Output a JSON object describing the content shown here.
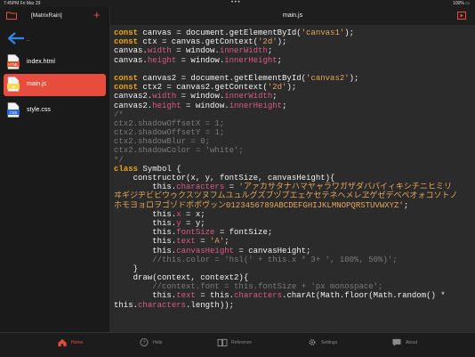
{
  "status": {
    "time": "7:45PM",
    "date": "Fri Mar 29",
    "battery": "100%"
  },
  "sidebar": {
    "title": "[MatrixRain]",
    "back_label": "..",
    "files": [
      {
        "name": "index.html",
        "type": "html",
        "color": "#e34c26"
      },
      {
        "name": "main.js",
        "type": "js",
        "color": "#f0db4f",
        "active": true
      },
      {
        "name": "style.css",
        "type": "css",
        "color": "#2965f1"
      }
    ]
  },
  "editor": {
    "filename": "main.js",
    "code_lines": [
      [
        {
          "t": "const ",
          "c": "kw"
        },
        {
          "t": "canvas = document.getElementById(",
          "c": "p"
        },
        {
          "t": "'canvas1'",
          "c": "s"
        },
        {
          "t": ");",
          "c": "p"
        }
      ],
      [
        {
          "t": "const ",
          "c": "kw"
        },
        {
          "t": "ctx = canvas.getContext(",
          "c": "p"
        },
        {
          "t": "'2d'",
          "c": "s"
        },
        {
          "t": ");",
          "c": "p"
        }
      ],
      [
        {
          "t": "canvas.",
          "c": "p"
        },
        {
          "t": "width",
          "c": "prop"
        },
        {
          "t": " = window.",
          "c": "p"
        },
        {
          "t": "innerWidth",
          "c": "prop"
        },
        {
          "t": ";",
          "c": "p"
        }
      ],
      [
        {
          "t": "canvas.",
          "c": "p"
        },
        {
          "t": "height",
          "c": "prop"
        },
        {
          "t": " = window.",
          "c": "p"
        },
        {
          "t": "innerHeight",
          "c": "prop"
        },
        {
          "t": ";",
          "c": "p"
        }
      ],
      [],
      [
        {
          "t": "const ",
          "c": "kw"
        },
        {
          "t": "canvas2 = document.getElementById(",
          "c": "p"
        },
        {
          "t": "'canvas2'",
          "c": "s"
        },
        {
          "t": ");",
          "c": "p"
        }
      ],
      [
        {
          "t": "const ",
          "c": "kw"
        },
        {
          "t": "ctx2 = canvas2.getContext(",
          "c": "p"
        },
        {
          "t": "'2d'",
          "c": "s"
        },
        {
          "t": ");",
          "c": "p"
        }
      ],
      [
        {
          "t": "canvas2.",
          "c": "p"
        },
        {
          "t": "width",
          "c": "prop"
        },
        {
          "t": " = window.",
          "c": "p"
        },
        {
          "t": "innerWidth",
          "c": "prop"
        },
        {
          "t": ";",
          "c": "p"
        }
      ],
      [
        {
          "t": "canvas2.",
          "c": "p"
        },
        {
          "t": "height",
          "c": "prop"
        },
        {
          "t": " = window.",
          "c": "p"
        },
        {
          "t": "innerHeight",
          "c": "prop"
        },
        {
          "t": ";",
          "c": "p"
        }
      ],
      [
        {
          "t": "/*",
          "c": "cm"
        }
      ],
      [
        {
          "t": "ctx2.shadowOffsetX = 1;",
          "c": "cm"
        }
      ],
      [
        {
          "t": "ctx2.shadowOffsetY = 1;",
          "c": "cm"
        }
      ],
      [
        {
          "t": "ctx2.shadowBlur = 0;",
          "c": "cm"
        }
      ],
      [
        {
          "t": "ctx2.shadowColor = 'white';",
          "c": "cm"
        }
      ],
      [
        {
          "t": "*/",
          "c": "cm"
        }
      ],
      [
        {
          "t": "class ",
          "c": "kw"
        },
        {
          "t": "Symbol {",
          "c": "p"
        }
      ],
      [
        {
          "t": "    constructor(x, y, fontSize, canvasHeight){",
          "c": "p"
        }
      ],
      [
        {
          "t": "        this.",
          "c": "p"
        },
        {
          "t": "characters",
          "c": "prop"
        },
        {
          "t": " = ",
          "c": "p"
        },
        {
          "t": "'アァカサタナハマヤャラワガザダバパイィキシチニヒミリ",
          "c": "s"
        }
      ],
      [
        {
          "t": "ヰギジヂビピウゥクスツヌフムユュルグズブヅプエェケセテネヘメレヱゲゼデベペオォコソトノ",
          "c": "s"
        }
      ],
      [
        {
          "t": "ホモヨョロヲゴゾドボポヴッン0123456789ABCDEFGHIJKLMNOPQRSTUVWXYZ'",
          "c": "s"
        },
        {
          "t": ";",
          "c": "p"
        }
      ],
      [
        {
          "t": "        this.",
          "c": "p"
        },
        {
          "t": "x",
          "c": "prop"
        },
        {
          "t": " = x;",
          "c": "p"
        }
      ],
      [
        {
          "t": "        this.",
          "c": "p"
        },
        {
          "t": "y",
          "c": "prop"
        },
        {
          "t": " = y;",
          "c": "p"
        }
      ],
      [
        {
          "t": "        this.",
          "c": "p"
        },
        {
          "t": "fontSize",
          "c": "prop"
        },
        {
          "t": " = fontSize;",
          "c": "p"
        }
      ],
      [
        {
          "t": "        this.",
          "c": "p"
        },
        {
          "t": "text",
          "c": "prop"
        },
        {
          "t": " = ",
          "c": "p"
        },
        {
          "t": "'A'",
          "c": "s"
        },
        {
          "t": ";",
          "c": "p"
        }
      ],
      [
        {
          "t": "        this.",
          "c": "p"
        },
        {
          "t": "canvasHeight",
          "c": "prop"
        },
        {
          "t": " = canvasHeight;",
          "c": "p"
        }
      ],
      [
        {
          "t": "        //this.color = 'hsl(' + this.x * 3+ ', 100%, 50%)';",
          "c": "cm"
        }
      ],
      [
        {
          "t": "    }",
          "c": "p"
        }
      ],
      [
        {
          "t": "    draw(context, context2){",
          "c": "p"
        }
      ],
      [
        {
          "t": "        //context.font = this.fontSize + 'px monospace';",
          "c": "cm"
        }
      ],
      [
        {
          "t": "        this.",
          "c": "p"
        },
        {
          "t": "text",
          "c": "prop"
        },
        {
          "t": " = this.",
          "c": "p"
        },
        {
          "t": "characters",
          "c": "prop"
        },
        {
          "t": ".charAt(Math.floor(Math.random() *",
          "c": "p"
        }
      ],
      [
        {
          "t": "this.",
          "c": "p"
        },
        {
          "t": "characters",
          "c": "prop"
        },
        {
          "t": ".length));",
          "c": "p"
        }
      ]
    ]
  },
  "tabbar": {
    "items": [
      {
        "label": "Home",
        "icon": "home-icon",
        "active": true
      },
      {
        "label": "Help",
        "icon": "help-icon"
      },
      {
        "label": "Reference",
        "icon": "book-icon"
      },
      {
        "label": "Settings",
        "icon": "gear-icon"
      },
      {
        "label": "About",
        "icon": "chat-icon"
      }
    ]
  },
  "colors": {
    "accent": "#e74c3c",
    "keyword": "#f0a30a",
    "string": "#e5a65b",
    "property": "#d85a86",
    "comment": "#7a7a7a",
    "plain": "#f2f2f2"
  }
}
